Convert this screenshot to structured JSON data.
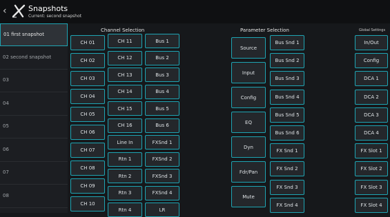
{
  "header": {
    "back_symbol": "‹",
    "title": "Snapshots",
    "subtitle": "Current: second snapshot"
  },
  "snapshots": [
    {
      "label": "01 first snapshot",
      "active": true
    },
    {
      "label": "02 second snapshot",
      "active": false
    },
    {
      "label": "03",
      "active": false
    },
    {
      "label": "04",
      "active": false
    },
    {
      "label": "05",
      "active": false
    },
    {
      "label": "06",
      "active": false
    },
    {
      "label": "07",
      "active": false
    },
    {
      "label": "08",
      "active": false
    }
  ],
  "channel_selection": {
    "title": "Channel Selection",
    "col1": [
      "CH 01",
      "CH 02",
      "CH 03",
      "CH 04",
      "CH 05",
      "CH 06",
      "CH 07",
      "CH 08",
      "CH 09",
      "CH 10"
    ],
    "col2": [
      "CH 11",
      "CH 12",
      "CH 13",
      "CH 14",
      "CH 15",
      "CH 16",
      "Line In",
      "Rtn 1",
      "Rtn 2",
      "Rtn 3",
      "Rtn 4"
    ],
    "col3": [
      "Bus 1",
      "Bus 2",
      "Bus 3",
      "Bus 4",
      "Bus 5",
      "Bus 6",
      "FXSnd 1",
      "FXSnd 2",
      "FXSnd 3",
      "FXSnd 4",
      "LR"
    ]
  },
  "parameter_selection": {
    "title": "Parameter Selection",
    "params": [
      "Source",
      "Input",
      "Config",
      "EQ",
      "Dyn",
      "Fdr/Pan",
      "Mute"
    ],
    "sends": [
      "Bus Snd 1",
      "Bus Snd 2",
      "Bus Snd 3",
      "Bus Snd 4",
      "Bus Snd 5",
      "Bus Snd 6",
      "FX Snd 1",
      "FX Snd 2",
      "FX Snd 3",
      "FX Snd 4"
    ]
  },
  "global_settings": {
    "title": "Global Settings",
    "items": [
      "In/Out",
      "Config",
      "DCA 1",
      "DCA 2",
      "DCA 3",
      "DCA 4",
      "FX Slot 1",
      "FX Slot 2",
      "FX Slot 3",
      "FX Slot 4"
    ]
  }
}
